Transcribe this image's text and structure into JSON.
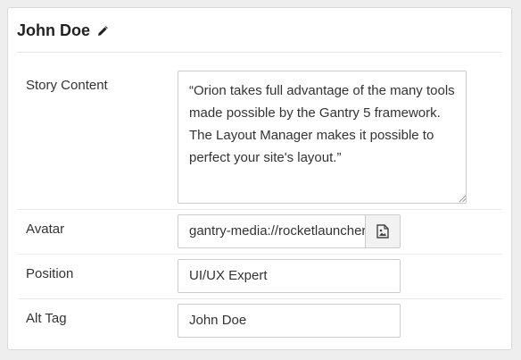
{
  "panel": {
    "title": "John Doe"
  },
  "fields": {
    "story_content": {
      "label": "Story Content",
      "value": "“Orion takes full advantage of the many tools made possible by the Gantry 5 framework. The Layout Manager makes it possible to perfect your site's layout.”"
    },
    "avatar": {
      "label": "Avatar",
      "value": "gantry-media://rocketlauncher"
    },
    "position": {
      "label": "Position",
      "value": "UI/UX Expert"
    },
    "alt_tag": {
      "label": "Alt Tag",
      "value": "John Doe"
    }
  },
  "icons": {
    "edit": "pencil-icon",
    "media": "image-file-icon"
  }
}
